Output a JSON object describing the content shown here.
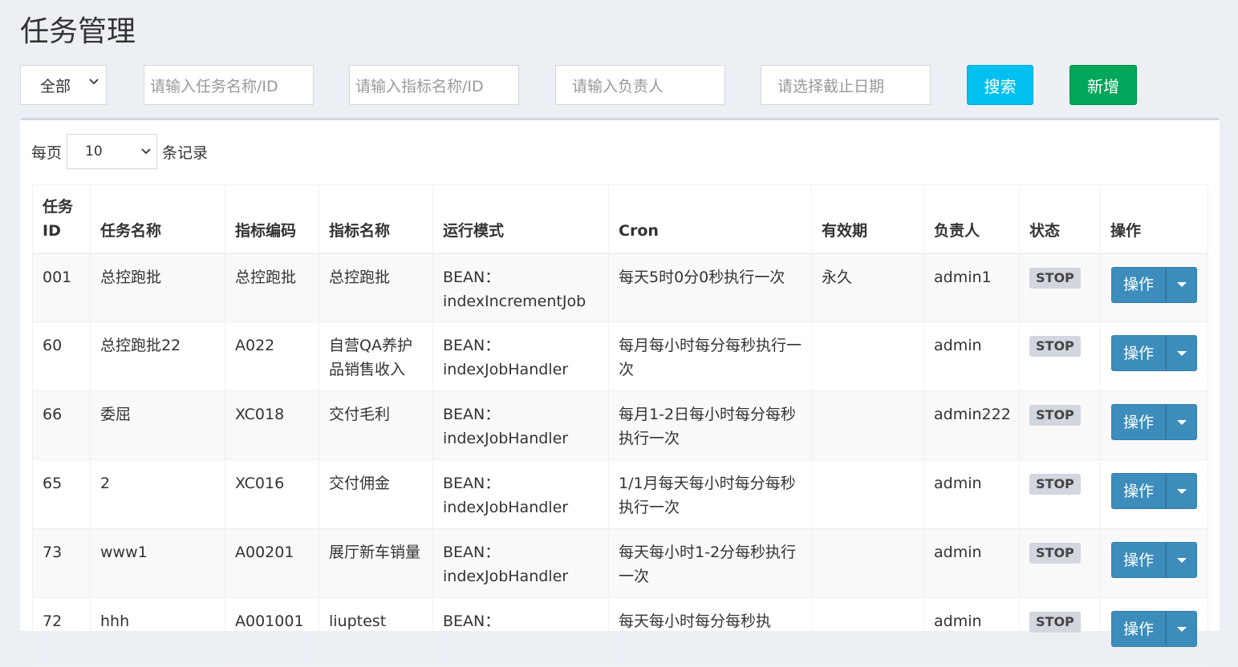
{
  "page": {
    "title": "任务管理"
  },
  "filters": {
    "status_select": "全部",
    "task_placeholder": "请输入任务名称/ID",
    "indicator_placeholder": "请输入指标名称/ID",
    "owner_placeholder": "请输入负责人",
    "date_placeholder": "请选择截止日期",
    "search_label": "搜索",
    "add_label": "新增"
  },
  "pager": {
    "prefix": "每页",
    "size": "10",
    "suffix": "条记录"
  },
  "table": {
    "headers": [
      "任务ID",
      "任务名称",
      "指标编码",
      "指标名称",
      "运行模式",
      "Cron",
      "有效期",
      "负责人",
      "状态",
      "操作"
    ],
    "rows": [
      {
        "id": "001",
        "name": "总控跑批",
        "code": "总控跑批",
        "indicator": "总控跑批",
        "mode": "BEAN：indexIncrementJob",
        "cron": "每天5时0分0秒执行一次",
        "validity": "永久",
        "owner": "admin1",
        "status": "STOP",
        "action": "操作"
      },
      {
        "id": "60",
        "name": "总控跑批22",
        "code": "A022",
        "indicator": "自营QA养护品销售收入",
        "mode": "BEAN：indexJobHandler",
        "cron": "每月每小时每分每秒执行一次",
        "validity": "",
        "owner": "admin",
        "status": "STOP",
        "action": "操作"
      },
      {
        "id": "66",
        "name": "委屈",
        "code": "XC018",
        "indicator": "交付毛利",
        "mode": "BEAN：indexJobHandler",
        "cron": "每月1-2日每小时每分每秒执行一次",
        "validity": "",
        "owner": "admin222",
        "status": "STOP",
        "action": "操作"
      },
      {
        "id": "65",
        "name": "2",
        "code": "XC016",
        "indicator": "交付佣金",
        "mode": "BEAN：indexJobHandler",
        "cron": "1/1月每天每小时每分每秒执行一次",
        "validity": "",
        "owner": "admin",
        "status": "STOP",
        "action": "操作"
      },
      {
        "id": "73",
        "name": "www1",
        "code": "A00201",
        "indicator": "展厅新车销量",
        "mode": "BEAN：indexJobHandler",
        "cron": "每天每小时1-2分每秒执行一次",
        "validity": "",
        "owner": "admin",
        "status": "STOP",
        "action": "操作"
      },
      {
        "id": "72",
        "name": "hhh",
        "code": "A001001",
        "indicator": "liuptest",
        "mode": "BEAN：",
        "cron": "每天每小时每分每秒执",
        "validity": "",
        "owner": "admin",
        "status": "STOP",
        "action": "操作"
      }
    ]
  },
  "colors": {
    "info": "#00c0ef",
    "success": "#00a65a",
    "primary": "#3c8dbc",
    "badge": "#d2d6de"
  }
}
